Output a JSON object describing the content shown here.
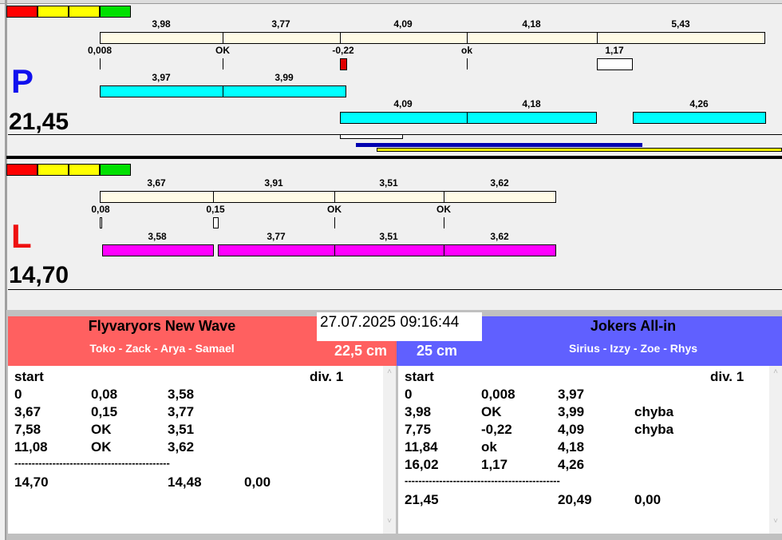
{
  "colors": {
    "red": "#ff0000",
    "yellow": "#ffff00",
    "green": "#00e000",
    "left_team": "#ff6060",
    "right_team": "#6060ff"
  },
  "p_lane": {
    "letter": "P",
    "total": "21,45",
    "top_segments": [
      "3,98",
      "3,77",
      "4,09",
      "4,18",
      "5,43"
    ],
    "marks": [
      "0,008",
      "OK",
      "-0,22",
      "ok",
      "1,17"
    ],
    "cyan_row1": [
      "3,97",
      "3,99"
    ],
    "cyan_row2": [
      "4,09",
      "4,18",
      "4,26"
    ]
  },
  "l_lane": {
    "letter": "L",
    "total": "14,70",
    "top_segments": [
      "3,67",
      "3,91",
      "3,51",
      "3,62"
    ],
    "marks": [
      "0,08",
      "0,15",
      "OK",
      "OK"
    ],
    "magenta_row": [
      "3,58",
      "3,77",
      "3,51",
      "3,62"
    ]
  },
  "timestamp": "27.07.2025 09:16:44",
  "left_team": {
    "name": "Flyvaryors New Wave",
    "members": "Toko - Zack - Arya - Samael",
    "distance": "22,5 cm",
    "start": "start",
    "div": "div.  1",
    "rows": [
      [
        "0",
        "0,08",
        "3,58",
        ""
      ],
      [
        "3,67",
        "0,15",
        "3,77",
        ""
      ],
      [
        "7,58",
        "OK",
        "3,51",
        ""
      ],
      [
        "11,08",
        "OK",
        "3,62",
        ""
      ]
    ],
    "separator": "---------------------------------------------",
    "totals": [
      "14,70",
      "14,48",
      "0,00"
    ]
  },
  "right_team": {
    "name": "Jokers All-in",
    "members": "Sirius - Izzy - Zoe - Rhys",
    "distance": "25 cm",
    "start": "start",
    "div": "div.  1",
    "rows": [
      [
        "0",
        "0,008",
        "3,97",
        ""
      ],
      [
        "3,98",
        "OK",
        "3,99",
        "chyba"
      ],
      [
        "7,75",
        "-0,22",
        "4,09",
        "chyba"
      ],
      [
        "11,84",
        "ok",
        "4,18",
        ""
      ],
      [
        "16,02",
        "1,17",
        "4,26",
        ""
      ]
    ],
    "separator": "---------------------------------------------",
    "totals": [
      "21,45",
      "20,49",
      "0,00"
    ]
  }
}
